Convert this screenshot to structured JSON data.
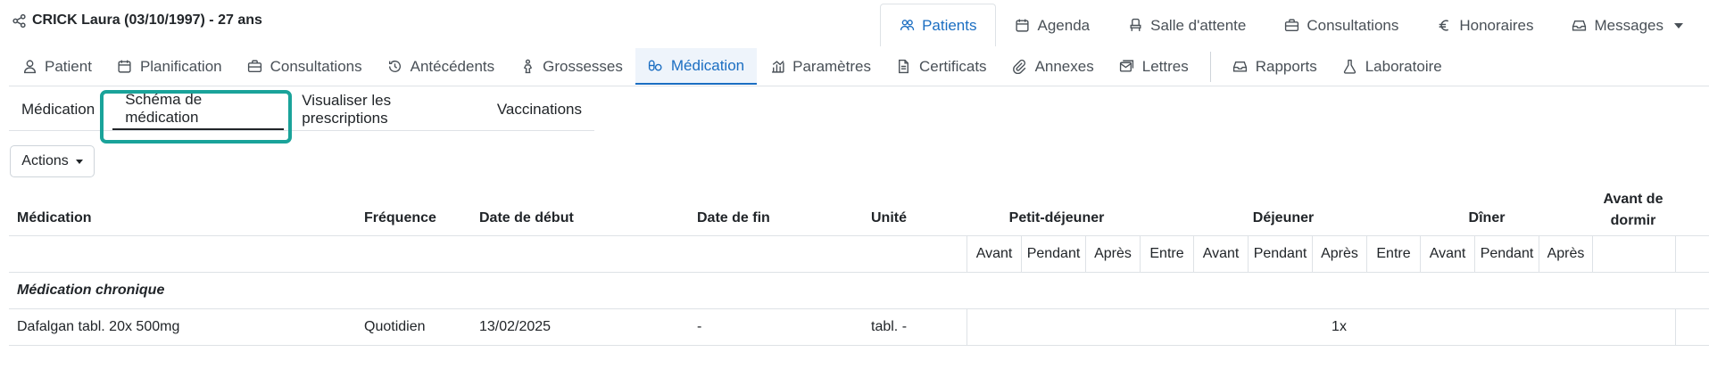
{
  "patient": {
    "title": "CRICK Laura (03/10/1997) - 27 ans"
  },
  "main_nav": [
    {
      "label": "Patients",
      "icon": "users-icon",
      "active": true
    },
    {
      "label": "Agenda",
      "icon": "calendar-icon"
    },
    {
      "label": "Salle d'attente",
      "icon": "chair-icon"
    },
    {
      "label": "Consultations",
      "icon": "briefcase-icon"
    },
    {
      "label": "Honoraires",
      "icon": "euro-icon"
    },
    {
      "label": "Messages",
      "icon": "inbox-icon"
    }
  ],
  "sub_nav": [
    {
      "label": "Patient",
      "icon": "person-icon"
    },
    {
      "label": "Planification",
      "icon": "calendar-icon"
    },
    {
      "label": "Consultations",
      "icon": "briefcase-icon"
    },
    {
      "label": "Antécédents",
      "icon": "history-icon"
    },
    {
      "label": "Grossesses",
      "icon": "pregnancy-icon"
    },
    {
      "label": "Médication",
      "icon": "pills-icon",
      "active": true
    },
    {
      "label": "Paramètres",
      "icon": "chart-icon"
    },
    {
      "label": "Certificats",
      "icon": "document-icon"
    },
    {
      "label": "Annexes",
      "icon": "paperclip-icon"
    },
    {
      "label": "Lettres",
      "icon": "letters-icon"
    },
    {
      "label": "Rapports",
      "icon": "inbox-icon"
    },
    {
      "label": "Laboratoire",
      "icon": "flask-icon"
    }
  ],
  "tabs": [
    {
      "label": "Médication"
    },
    {
      "label": "Schéma de médication",
      "active": true
    },
    {
      "label": "Visualiser les prescriptions"
    },
    {
      "label": "Vaccinations"
    }
  ],
  "actions": {
    "label": "Actions"
  },
  "table": {
    "headers": {
      "medication": "Médication",
      "frequency": "Fréquence",
      "start_date": "Date de début",
      "end_date": "Date de fin",
      "unit": "Unité",
      "breakfast": "Petit-déjeuner",
      "lunch": "Déjeuner",
      "dinner": "Dîner",
      "bedtime_line1": "Avant de",
      "bedtime_line2": "dormir"
    },
    "subheaders": [
      "Avant",
      "Pendant",
      "Après",
      "Entre",
      "Avant",
      "Pendant",
      "Après",
      "Entre",
      "Avant",
      "Pendant",
      "Après"
    ],
    "group_label": "Médication chronique",
    "rows": [
      {
        "medication": "Dafalgan tabl. 20x 500mg",
        "frequency": "Quotidien",
        "start_date": "13/02/2025",
        "end_date": "-",
        "unit": "tabl. -",
        "dose": "1x"
      }
    ]
  },
  "colors": {
    "accent": "#1b6ec2",
    "highlight": "#1aa39a"
  }
}
